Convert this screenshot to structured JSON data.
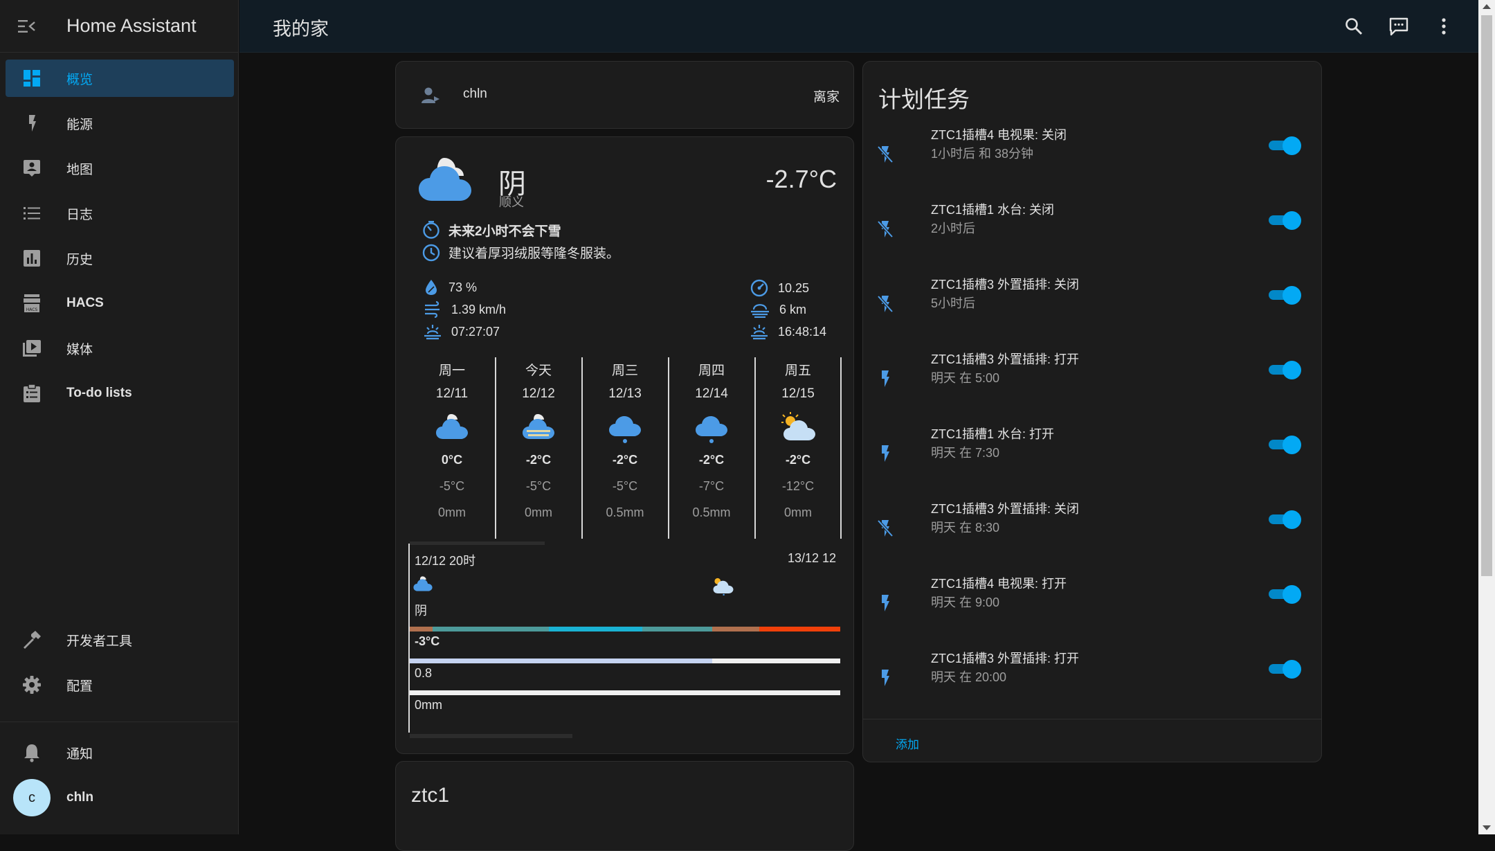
{
  "app": {
    "title": "Home Assistant"
  },
  "page": {
    "title": "我的家"
  },
  "sidebar": {
    "items": [
      {
        "label": "概览",
        "icon": "dashboard-icon",
        "active": true
      },
      {
        "label": "能源",
        "icon": "lightning-icon"
      },
      {
        "label": "地图",
        "icon": "map-icon"
      },
      {
        "label": "日志",
        "icon": "list-icon"
      },
      {
        "label": "历史",
        "icon": "chart-bar-icon"
      },
      {
        "label": "HACS",
        "icon": "hacs-icon"
      },
      {
        "label": "媒体",
        "icon": "media-play-icon"
      },
      {
        "label": "To-do lists",
        "icon": "clipboard-list-icon"
      },
      {
        "label": "开发者工具",
        "icon": "hammer-icon"
      },
      {
        "label": "配置",
        "icon": "gear-icon"
      },
      {
        "label": "通知",
        "icon": "bell-icon"
      }
    ],
    "user": {
      "name": "chln",
      "initial": "c"
    }
  },
  "person": {
    "name": "chln",
    "state": "离家"
  },
  "weather": {
    "condition": "阴",
    "location": "顺义",
    "temperature": "-2.7°C",
    "alert": "未来2小时不会下雪",
    "advice": "建议着厚羽绒服等隆冬服装。",
    "humidity": "73 %",
    "wind_speed": "1.39 km/h",
    "sunrise": "07:27:07",
    "pressure": "10.25",
    "visibility": "6 km",
    "sunset": "16:48:14",
    "forecast": [
      {
        "day": "周一",
        "date": "12/11",
        "high": "0°C",
        "low": "-5°C",
        "precip": "0mm",
        "icon": "cloudy-icon"
      },
      {
        "day": "今天",
        "date": "12/12",
        "high": "-2°C",
        "low": "-5°C",
        "precip": "0mm",
        "icon": "fog-icon"
      },
      {
        "day": "周三",
        "date": "12/13",
        "high": "-2°C",
        "low": "-5°C",
        "precip": "0.5mm",
        "icon": "snow-icon"
      },
      {
        "day": "周四",
        "date": "12/14",
        "high": "-2°C",
        "low": "-7°C",
        "precip": "0.5mm",
        "icon": "snow-icon"
      },
      {
        "day": "周五",
        "date": "12/15",
        "high": "-2°C",
        "low": "-12°C",
        "precip": "0mm",
        "icon": "partly-cloudy-icon"
      }
    ],
    "hourly": {
      "start": "12/12 20时",
      "end": "13/12 12",
      "condition": "阴",
      "temp": "-3°C",
      "value": "0.8",
      "precip": "0mm"
    }
  },
  "schedule": {
    "title": "计划任务",
    "add_label": "添加",
    "items": [
      {
        "name": "ZTC1插槽4 电视果: 关闭",
        "time": "1小时后 和 38分钟",
        "action": "off"
      },
      {
        "name": "ZTC1插槽1 水台: 关闭",
        "time": "2小时后",
        "action": "off"
      },
      {
        "name": "ZTC1插槽3 外置插排: 关闭",
        "time": "5小时后",
        "action": "off"
      },
      {
        "name": "ZTC1插槽3 外置插排: 打开",
        "time": "明天 在 5:00",
        "action": "on"
      },
      {
        "name": "ZTC1插槽1 水台: 打开",
        "time": "明天 在 7:30",
        "action": "on"
      },
      {
        "name": "ZTC1插槽3 外置插排: 关闭",
        "time": "明天 在 8:30",
        "action": "off"
      },
      {
        "name": "ZTC1插槽4 电视果: 打开",
        "time": "明天 在 9:00",
        "action": "on"
      },
      {
        "name": "ZTC1插槽3 外置插排: 打开",
        "time": "明天 在 20:00",
        "action": "on"
      }
    ]
  },
  "ztc_card": {
    "title": "ztc1"
  },
  "colors": {
    "accent": "#03a9f4",
    "active_bg": "#1e3f5a",
    "sidebar_bg": "#1c1c1c",
    "card_bg": "#1c1c1c",
    "topbar_bg": "#111c25"
  }
}
